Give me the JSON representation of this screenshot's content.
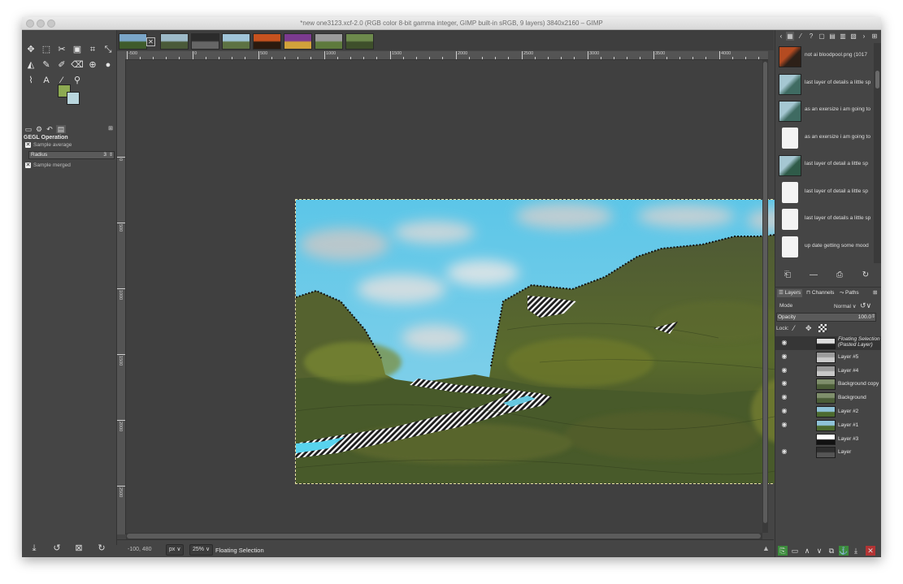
{
  "window": {
    "title": "*new one3123.xcf-2.0 (RGB color 8-bit gamma integer, GIMP built-in sRGB, 9 layers) 3840x2160 – GIMP"
  },
  "toolbox": {
    "tools": [
      {
        "icon": "move-icon",
        "glyph": "✥"
      },
      {
        "icon": "rect-select-icon",
        "glyph": "⬚"
      },
      {
        "icon": "scissors-select-icon",
        "glyph": "✂"
      },
      {
        "icon": "foreground-select-icon",
        "glyph": "▣"
      },
      {
        "icon": "crop-icon",
        "glyph": "⌗"
      },
      {
        "icon": "transform-icon",
        "glyph": "⤡"
      },
      {
        "icon": "fill-icon",
        "glyph": "◭"
      },
      {
        "icon": "paint-icon",
        "glyph": "✎"
      },
      {
        "icon": "airbrush-icon",
        "glyph": "✐"
      },
      {
        "icon": "eraser-icon",
        "glyph": "⌫"
      },
      {
        "icon": "clone-icon",
        "glyph": "⊕"
      },
      {
        "icon": "dodge-icon",
        "glyph": "●"
      },
      {
        "icon": "paths-icon",
        "glyph": "⌇"
      },
      {
        "icon": "text-icon",
        "glyph": "A"
      },
      {
        "icon": "color-picker-icon",
        "glyph": "⁄"
      },
      {
        "icon": "zoom-icon",
        "glyph": "⚲"
      }
    ],
    "fg_color": "#8daa52",
    "bg_color": "#b9d6de",
    "options_title": "GEGL Operation",
    "sample_average": "Sample average",
    "radius_label": "Radius",
    "radius_value": "3",
    "sample_merged": "Sample merged"
  },
  "image_tabs": [
    {
      "name": "tab-1",
      "c1": "#7aa6c9",
      "c2": "#3f5b2b"
    },
    {
      "name": "tab-2",
      "c1": "#9dbac9",
      "c2": "#4a5a39"
    },
    {
      "name": "tab-3",
      "c1": "#2b2b2b",
      "c2": "#666666"
    },
    {
      "name": "tab-4",
      "c1": "#a0c4d9",
      "c2": "#5d7243"
    },
    {
      "name": "tab-5",
      "c1": "#c7521f",
      "c2": "#2b1a0e"
    },
    {
      "name": "tab-6",
      "c1": "#7b3a8f",
      "c2": "#d2a23a"
    },
    {
      "name": "tab-7",
      "c1": "#9a9a9a",
      "c2": "#5e7a3c"
    },
    {
      "name": "tab-8",
      "c1": "#6d8a4c",
      "c2": "#3e4f2b"
    }
  ],
  "rulers": {
    "top": [
      "-500",
      "0",
      "500",
      "1000",
      "1500",
      "2000",
      "2500",
      "3000",
      "3500",
      "4000"
    ],
    "left": [
      "0",
      "500",
      "1000",
      "1500",
      "2000",
      "2500"
    ]
  },
  "statusbar": {
    "coords": "-100, 480",
    "unit": "px",
    "zoom": "25%",
    "message": "Floating Selection"
  },
  "history": [
    {
      "label": "not ai bloodpool.png (1017",
      "kind": "image",
      "c1": "#b44b21",
      "c2": "#2d2018"
    },
    {
      "label": "last layer of details a little sp",
      "kind": "image",
      "c1": "#a5c7d2",
      "c2": "#3f6b62"
    },
    {
      "label": "as an exersize i am going to",
      "kind": "image",
      "c1": "#a5c7d2",
      "c2": "#3f6b62"
    },
    {
      "label": "as an exersize i am going to",
      "kind": "doc"
    },
    {
      "label": "last layer of detail a little sp",
      "kind": "image",
      "c1": "#a5c7d2",
      "c2": "#2f5b49"
    },
    {
      "label": "last layer of detail a little sp",
      "kind": "doc"
    },
    {
      "label": "last layer of details a little sp",
      "kind": "doc"
    },
    {
      "label": "up date getting some mood",
      "kind": "doc"
    }
  ],
  "layers_panel": {
    "tabs": [
      "Layers",
      "Channels",
      "Paths"
    ],
    "mode_label": "Mode",
    "mode_value": "Normal",
    "opacity_label": "Opacity",
    "opacity_value": "100.0",
    "lock_label": "Lock:",
    "layers": [
      {
        "name": "Floating Selection",
        "name2": "(Pasted Layer)",
        "visible": true,
        "floating": true,
        "c1": "#dddddd",
        "c2": "#222222"
      },
      {
        "name": "Layer #5",
        "visible": true,
        "c1": "#9b9b9b",
        "c2": "#c9c9c9"
      },
      {
        "name": "Layer #4",
        "visible": true,
        "c1": "#9b9b9b",
        "c2": "#c9c9c9"
      },
      {
        "name": "Background copy",
        "visible": true,
        "c1": "#7f8f6c",
        "c2": "#4b5d38"
      },
      {
        "name": "Background",
        "visible": true,
        "c1": "#7f8f6c",
        "c2": "#4b5d38"
      },
      {
        "name": "Layer #2",
        "visible": true,
        "c1": "#8fc3d9",
        "c2": "#4c6a2f"
      },
      {
        "name": "Layer #1",
        "visible": true,
        "c1": "#8fc3d9",
        "c2": "#4c6a2f"
      },
      {
        "name": "Layer #3",
        "visible": false,
        "c1": "#ffffff",
        "c2": "#111111"
      },
      {
        "name": "Layer",
        "visible": true,
        "c1": "#2e2e2e",
        "c2": "#555555"
      }
    ]
  }
}
